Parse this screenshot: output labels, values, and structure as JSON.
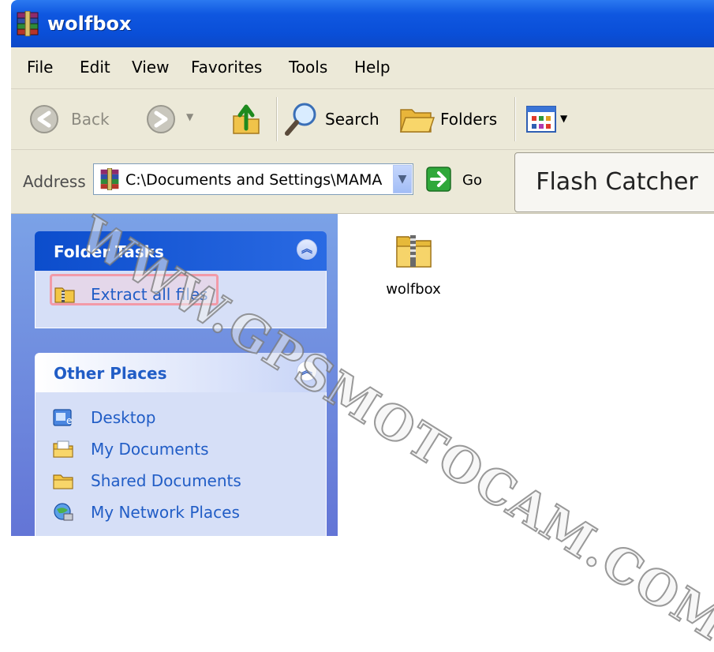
{
  "window": {
    "title": "wolfbox"
  },
  "menu": [
    "File",
    "Edit",
    "View",
    "Favorites",
    "Tools",
    "Help"
  ],
  "toolbar": {
    "back_label": "Back",
    "search_label": "Search",
    "folders_label": "Folders"
  },
  "address": {
    "label": "Address",
    "value": "C:\\Documents and Settings\\MAMA",
    "go_label": "Go"
  },
  "overlay_button": "Flash Catcher",
  "folder_tasks": {
    "title": "Folder Tasks",
    "items": [
      {
        "label": "Extract all files",
        "icon": "zip-extract-icon"
      }
    ]
  },
  "other_places": {
    "title": "Other Places",
    "items": [
      {
        "label": "Desktop",
        "icon": "desktop-icon"
      },
      {
        "label": "My Documents",
        "icon": "my-documents-icon"
      },
      {
        "label": "Shared Documents",
        "icon": "shared-folder-icon"
      },
      {
        "label": "My Network Places",
        "icon": "network-places-icon"
      }
    ]
  },
  "content": {
    "items": [
      {
        "name": "wolfbox",
        "icon": "zip-folder-icon"
      }
    ]
  },
  "watermark": "WWW.GPSMOTOCAM.COM",
  "colors": {
    "titlebar": "#0a4fd8",
    "chrome": "#ece9d8",
    "taskpane": "#6f8fe0",
    "link": "#215dc6",
    "highlight": "#f29aa8"
  }
}
